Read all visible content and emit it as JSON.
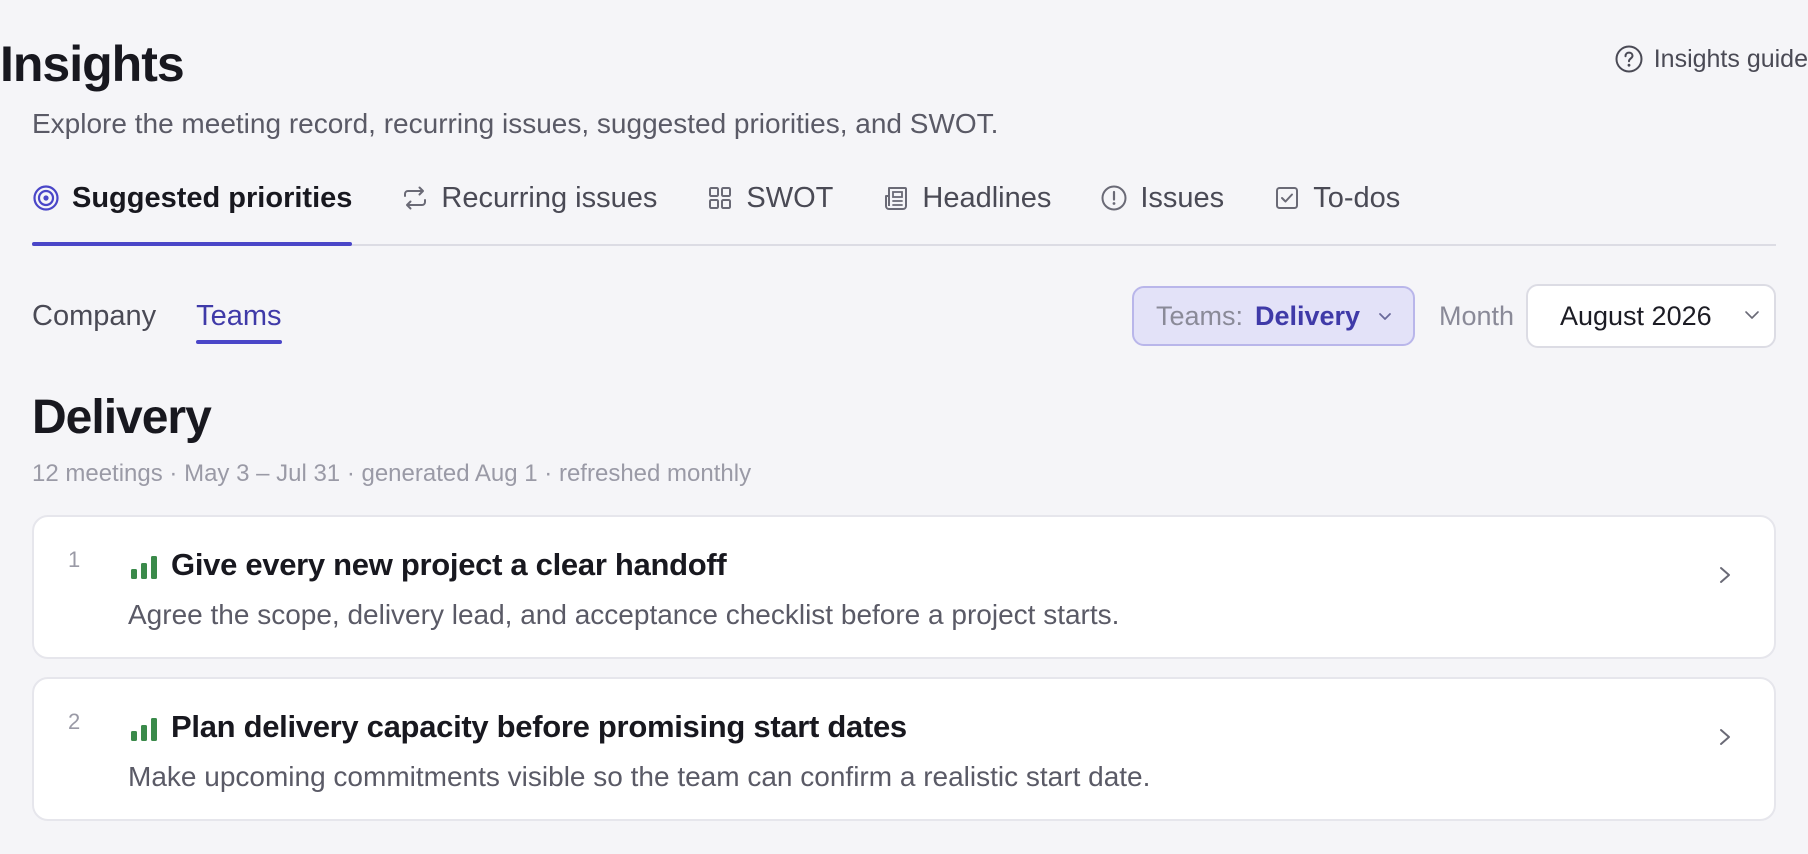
{
  "header": {
    "title": "Insights",
    "subtitle": "Explore the meeting record, recurring issues, suggested priorities, and SWOT.",
    "guide_label": "Insights guide"
  },
  "tabs": [
    {
      "label": "Suggested priorities",
      "icon": "target-icon",
      "active": true
    },
    {
      "label": "Recurring issues",
      "icon": "repeat-icon",
      "active": false
    },
    {
      "label": "SWOT",
      "icon": "grid-icon",
      "active": false
    },
    {
      "label": "Headlines",
      "icon": "newspaper-icon",
      "active": false
    },
    {
      "label": "Issues",
      "icon": "alert-circle-icon",
      "active": false
    },
    {
      "label": "To-dos",
      "icon": "checkbox-icon",
      "active": false
    }
  ],
  "subtabs": [
    {
      "label": "Company",
      "active": false
    },
    {
      "label": "Teams",
      "active": true
    }
  ],
  "filters": {
    "team_prefix": "Teams:",
    "team_value": "Delivery",
    "month_label": "Month",
    "month_value": "August 2026"
  },
  "section": {
    "title": "Delivery",
    "meta": "12 meetings · May 3 – Jul 31 · generated Aug 1 · refreshed monthly"
  },
  "priorities": [
    {
      "number": "1",
      "title": "Give every new project a clear handoff",
      "description": "Agree the scope, delivery lead, and acceptance checklist before a project starts.",
      "strength_icon": "signal-bars-icon"
    },
    {
      "number": "2",
      "title": "Plan delivery capacity before promising start dates",
      "description": "Make upcoming commitments visible so the team can confirm a realistic start date.",
      "strength_icon": "signal-bars-icon"
    }
  ],
  "colors": {
    "accent": "#4a46c8",
    "accent_text": "#3f3aa8",
    "signal_green": "#3a8a4a",
    "background": "#f5f5f8"
  }
}
